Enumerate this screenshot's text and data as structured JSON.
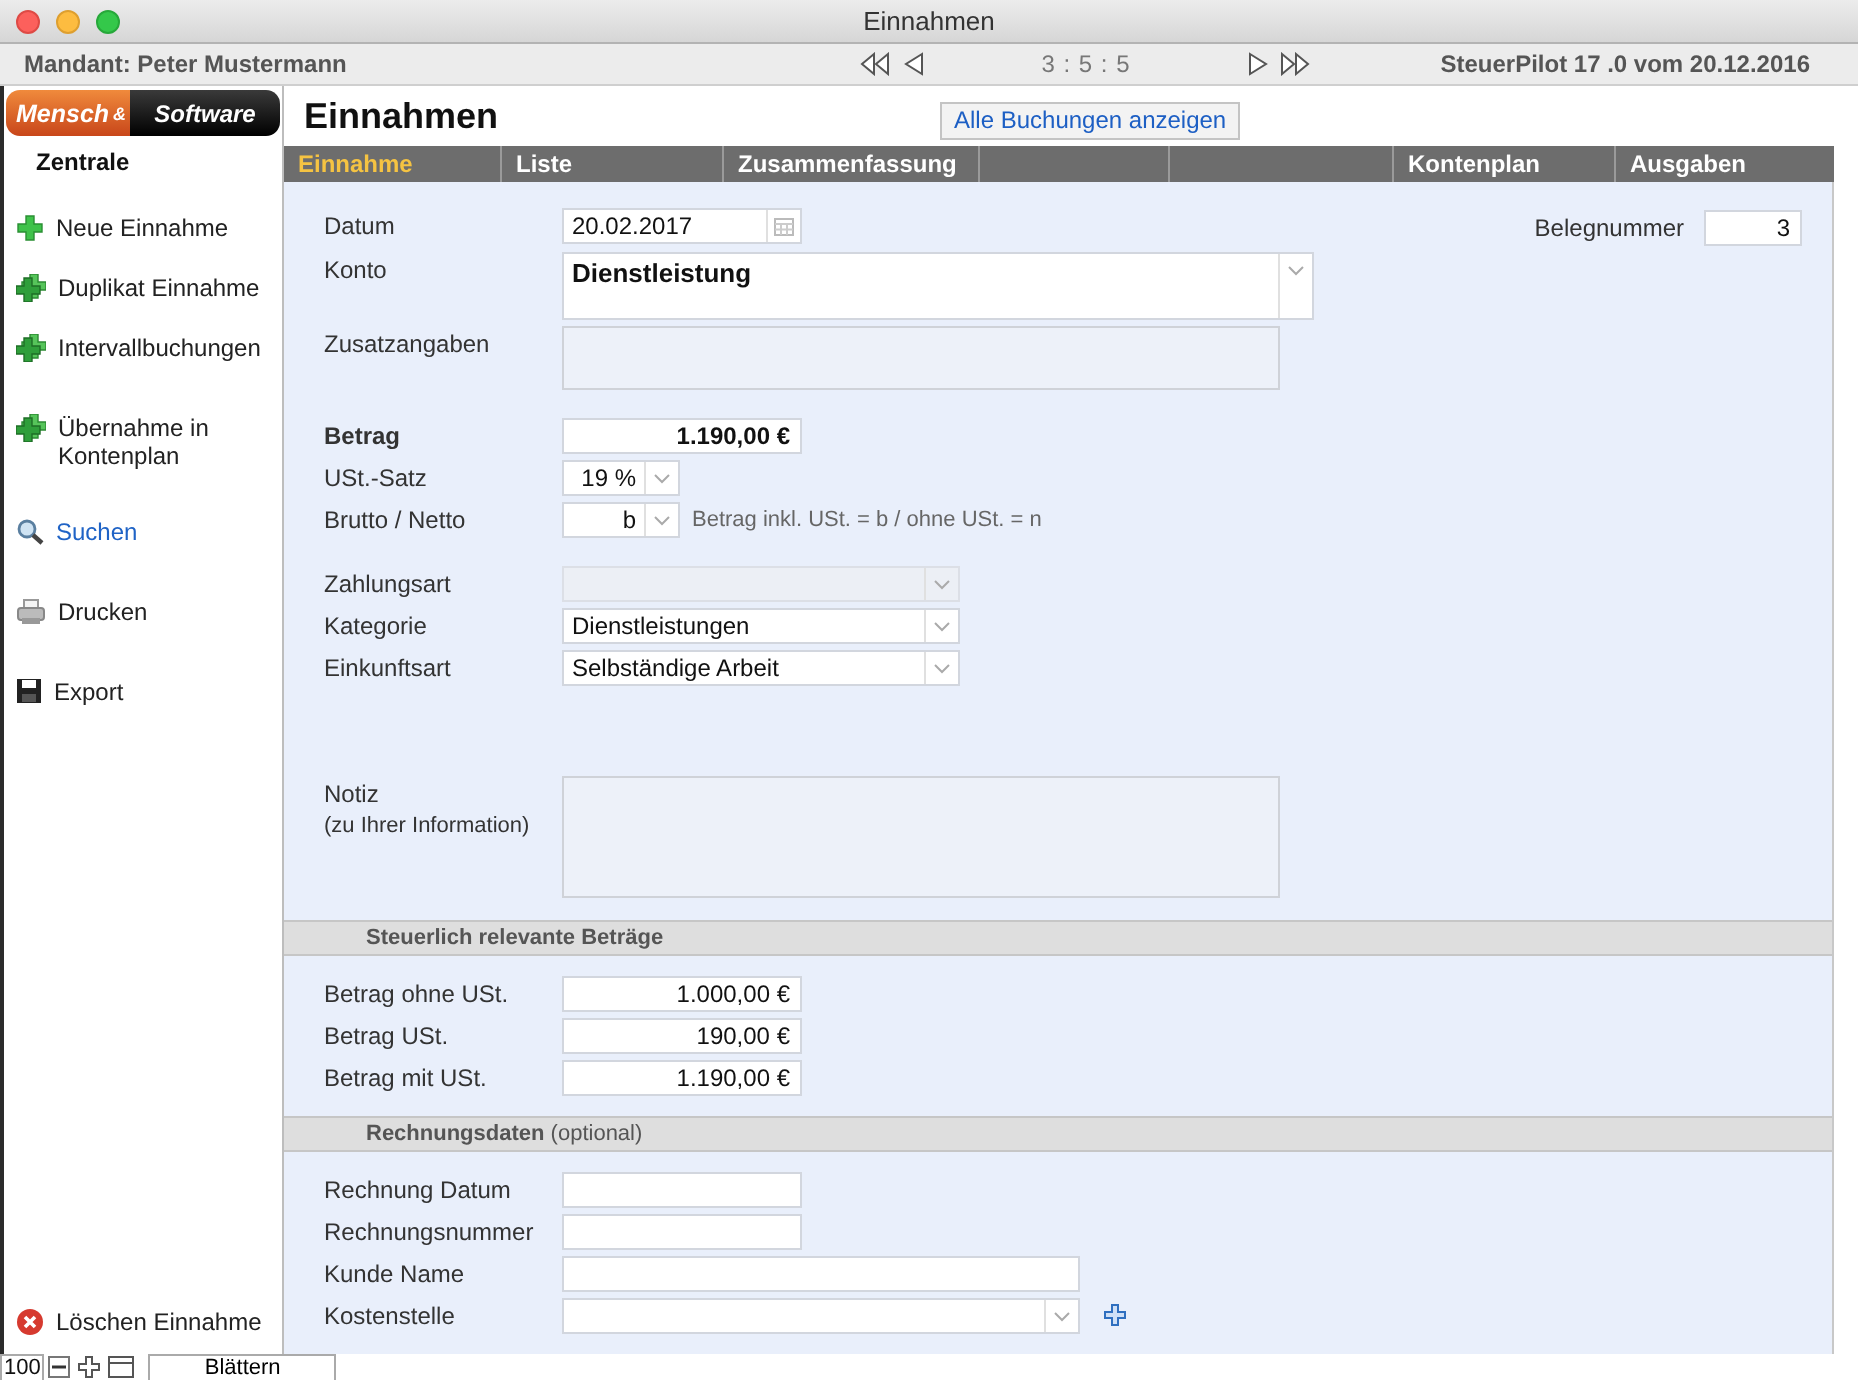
{
  "window": {
    "title": "Einnahmen"
  },
  "top_bar": {
    "mandant": "Mandant: Peter Mustermann",
    "record_counter": "3 : 5 : 5",
    "version": "SteuerPilot 17 .0 vom 20.12.2016"
  },
  "logo": {
    "left": "Mensch",
    "joiner": "&",
    "right": "Software"
  },
  "sidebar": {
    "title": "Zentrale",
    "items": [
      {
        "label": "Neue Einnahme",
        "kind": "plus",
        "selected": false
      },
      {
        "label": "Duplikat Einnahme",
        "kind": "duplicate",
        "selected": false
      },
      {
        "label": "Intervallbuchungen",
        "kind": "duplicate",
        "selected": false
      },
      {
        "label": "Übernahme in Kontenplan",
        "kind": "duplicate",
        "selected": false
      },
      {
        "label": "Suchen",
        "kind": "search",
        "selected": true
      },
      {
        "label": "Drucken",
        "kind": "print",
        "selected": false
      },
      {
        "label": "Export",
        "kind": "save",
        "selected": false
      },
      {
        "label": "Löschen Einnahme",
        "kind": "delete",
        "selected": false
      }
    ]
  },
  "page_title": "Einnahmen",
  "show_all_button": "Alle Buchungen anzeigen",
  "tabs": [
    {
      "kind": "label",
      "label": "Einnahme",
      "selected": true
    },
    {
      "kind": "label",
      "label": "Liste",
      "selected": false
    },
    {
      "kind": "label",
      "label": "Zusammenfassung",
      "selected": false
    },
    {
      "kind": "blank",
      "selected": false
    },
    {
      "kind": "blank",
      "selected": false
    },
    {
      "kind": "label",
      "label": "Kontenplan",
      "selected": false
    },
    {
      "kind": "label",
      "label": "Ausgaben",
      "selected": false
    }
  ],
  "form": {
    "belegnummer": {
      "label": "Belegnummer",
      "value": "3"
    },
    "groups": [
      [
        {
          "label": "Datum",
          "kind": "date",
          "value": "20.02.2017",
          "bold": false,
          "disabled": false
        },
        {
          "label": "Konto",
          "kind": "account",
          "value": "Dienstleistung",
          "bold": false,
          "disabled": false
        },
        {
          "label": "Zusatzangaben",
          "kind": "note",
          "bold": false,
          "disabled": false
        }
      ],
      [
        {
          "label": "Betrag",
          "kind": "amount",
          "value": "1.190,00 €",
          "bold": true,
          "disabled": false
        },
        {
          "label": "USt.-Satz",
          "kind": "mini-select",
          "value": "19 %",
          "bold": false,
          "disabled": false
        },
        {
          "label": "Brutto / Netto",
          "kind": "mini-select",
          "value": "b",
          "hint": "Betrag inkl. USt. = b / ohne USt. = n",
          "bold": false,
          "disabled": false
        }
      ],
      [
        {
          "label": "Zahlungsart",
          "kind": "select",
          "bold": false,
          "disabled": true
        },
        {
          "label": "Kategorie",
          "kind": "select",
          "value": "Dienstleistungen",
          "bold": false,
          "disabled": false
        },
        {
          "label": "Einkunftsart",
          "kind": "select",
          "value": "Selbständige Arbeit",
          "bold": false,
          "disabled": false
        }
      ],
      [
        {
          "label": "Notiz",
          "sublabel": "(zu Ihrer Information)",
          "kind": "memo",
          "bold": false,
          "disabled": false
        }
      ]
    ]
  },
  "sections": [
    {
      "title": "Steuerlich relevante Beträge",
      "rows": [
        {
          "label": "Betrag ohne USt.",
          "kind": "amount",
          "value": "1.000,00 €",
          "bold": false,
          "disabled": false
        },
        {
          "label": "Betrag USt.",
          "kind": "amount",
          "value": "190,00 €",
          "bold": false,
          "disabled": false
        },
        {
          "label": "Betrag mit USt.",
          "kind": "amount",
          "value": "1.190,00 €",
          "bold": false,
          "disabled": false
        }
      ]
    },
    {
      "title": "Rechnungsdaten",
      "note": "(optional)",
      "rows": [
        {
          "label": "Rechnung Datum",
          "kind": "text",
          "bold": false,
          "disabled": false
        },
        {
          "label": "Rechnungsnummer",
          "kind": "text",
          "bold": false,
          "disabled": false
        },
        {
          "label": "Kunde Name",
          "kind": "text-long",
          "bold": false,
          "disabled": false
        },
        {
          "label": "Kostenstelle",
          "kind": "select-add",
          "bold": false,
          "disabled": false
        }
      ]
    }
  ],
  "status_bar": {
    "zoom": "100",
    "mode": "Blättern"
  }
}
